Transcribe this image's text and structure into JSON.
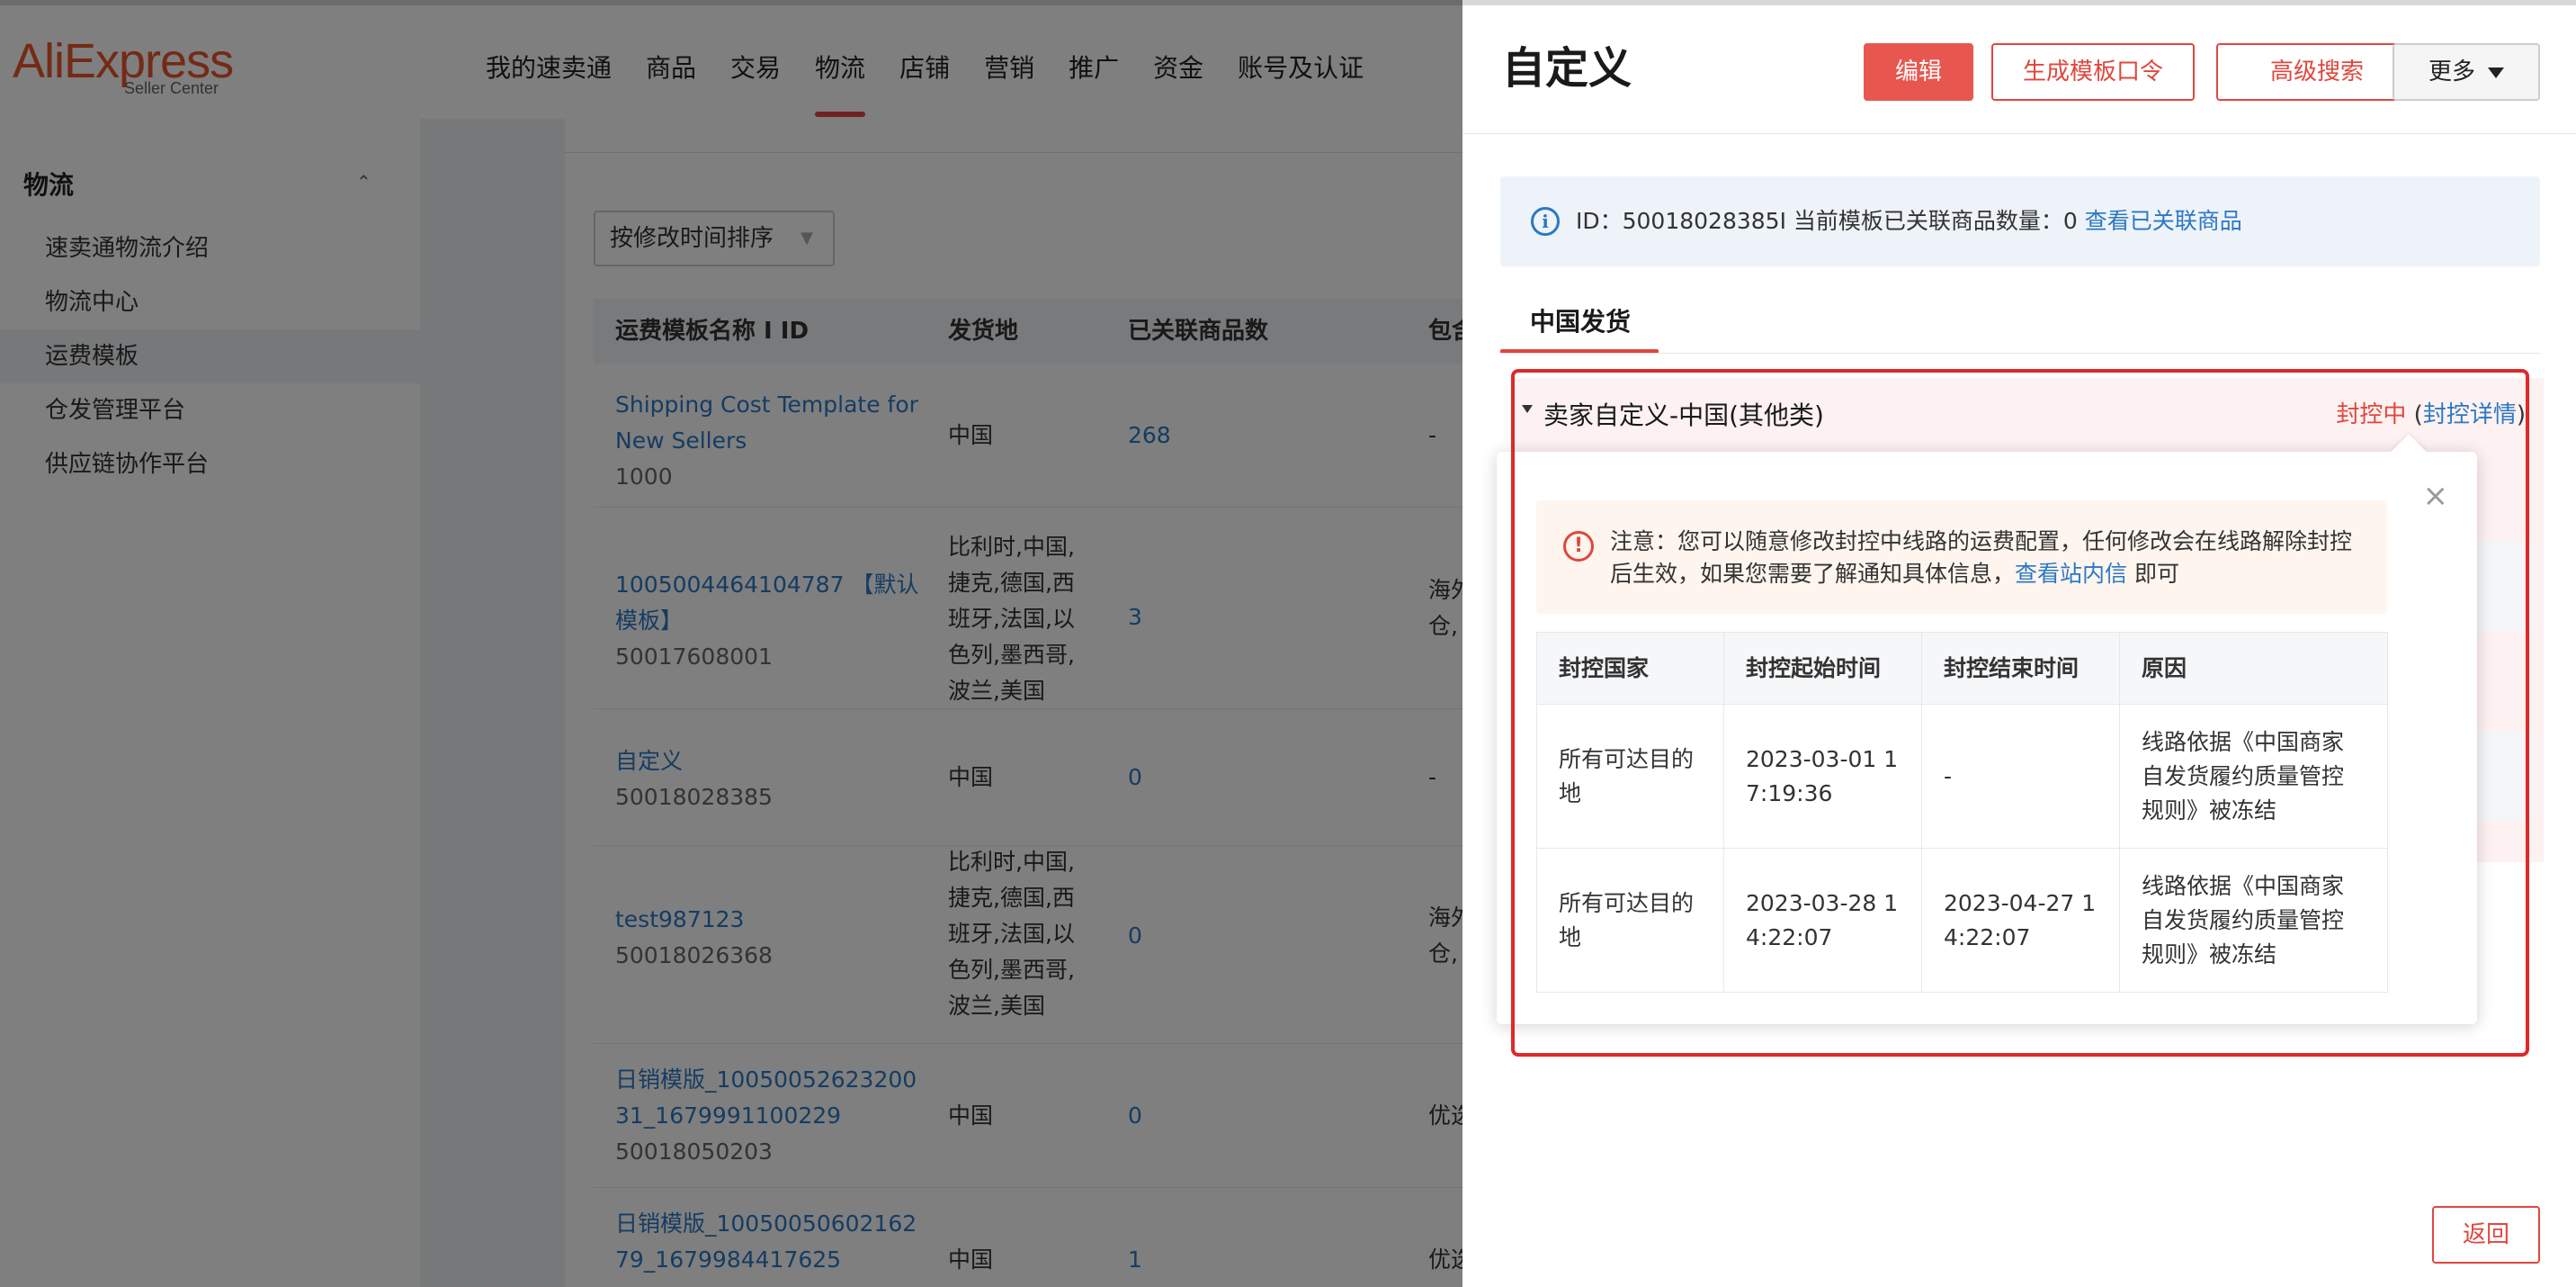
{
  "header": {
    "logo_text": "AliExpress",
    "logo_sub": "Seller Center",
    "nav": [
      "我的速卖通",
      "商品",
      "交易",
      "物流",
      "店铺",
      "营销",
      "推广",
      "资金",
      "账号及认证"
    ]
  },
  "sidebar": {
    "title": "物流",
    "items": [
      "速卖通物流介绍",
      "物流中心",
      "运费模板",
      "仓发管理平台",
      "供应链协作平台"
    ]
  },
  "list": {
    "sort_label": "按修改时间排序",
    "columns": [
      "运费模板名称 I ID",
      "发货地",
      "已关联商品数",
      "包含"
    ],
    "rows": [
      {
        "name": "Shipping Cost Template for New Sellers",
        "id": "1000",
        "origin": "中国",
        "count": "268",
        "pack": "-"
      },
      {
        "name": "1005004464104787 【默认模板】",
        "id": "50017608001",
        "origin": "比利时,中国,捷克,德国,西班牙,法国,以色列,墨西哥,波兰,美国",
        "count": "3",
        "pack": "海外仓,"
      },
      {
        "name": "自定义",
        "id": "50018028385",
        "origin": "中国",
        "count": "0",
        "pack": "-"
      },
      {
        "name": "test987123",
        "id": "50018026368",
        "origin": "比利时,中国,捷克,德国,西班牙,法国,以色列,墨西哥,波兰,美国",
        "count": "0",
        "pack": "海外仓,"
      },
      {
        "name": "日销模版_1005005262320031_1679991100229",
        "id": "50018050203",
        "origin": "中国",
        "count": "0",
        "pack": "优选"
      },
      {
        "name": "日销模版_1005005060216279_1679984417625",
        "id": "",
        "origin": "中国",
        "count": "1",
        "pack": "优选"
      }
    ]
  },
  "drawer": {
    "title": "自定义",
    "buttons": {
      "edit": "编辑",
      "gen_code": "生成模板口令",
      "adv_search": "高级搜索",
      "more": "更多"
    },
    "info": {
      "prefix": "ID：50018028385I 当前模板已关联商品数量：0 ",
      "link": "查看已关联商品"
    },
    "tab": "中国发货",
    "section": {
      "title": "卖家自定义-中国(其他类)",
      "status": "封控中",
      "paren_open": "(",
      "details_link": "封控详情",
      "paren_close": ")"
    },
    "popover": {
      "notice_text": "注意：您可以随意修改封控中线路的运费配置，任何修改会在线路解除封控后生效，如果您需要了解通知具体信息，",
      "notice_link": "查看站内信",
      "notice_suffix": " 即可",
      "table": {
        "headers": [
          "封控国家",
          "封控起始时间",
          "封控结束时间",
          "原因"
        ],
        "rows": [
          [
            "所有可达目的地",
            "2023-03-01 17:19:36",
            "-",
            "线路依据《中国商家自发货履约质量管控规则》被冻结"
          ],
          [
            "所有可达目的地",
            "2023-03-28 14:22:07",
            "2023-04-27 14:22:07",
            "线路依据《中国商家自发货履约质量管控规则》被冻结"
          ]
        ]
      }
    },
    "back": "返回"
  },
  "colors": {
    "brand": "#e8542a",
    "accent": "#e0473d",
    "link": "#2b78c5",
    "frame": "#e0282a"
  }
}
